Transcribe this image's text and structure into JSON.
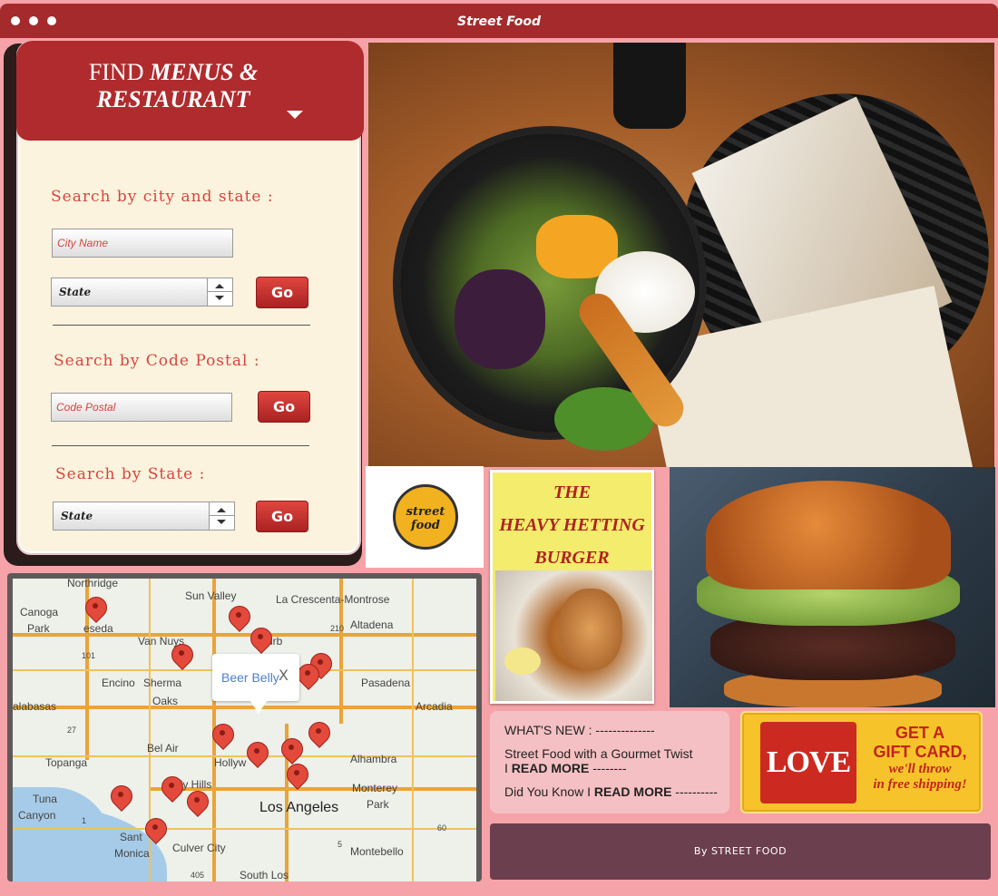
{
  "window": {
    "title": "Street Food"
  },
  "search": {
    "heading_prefix": "FIND ",
    "heading_emphasis_1": "MENUS &",
    "heading_emphasis_2": "RESTAURANT",
    "city_section_label": "Search by city and state :",
    "city_placeholder": "City Name",
    "state_select_value": "State",
    "postal_section_label": "Search by Code Postal :",
    "postal_placeholder": "Code Postal",
    "state_section_label": "Search by State :",
    "state_select_value_2": "State",
    "go_label": "Go"
  },
  "logo": {
    "text_1": "street",
    "text_2": "food"
  },
  "promo": {
    "line_1": "THE",
    "line_2": "HEAVY HETTING",
    "line_3": "BURGER"
  },
  "map": {
    "popup_label": "Beer Belly",
    "popup_close": "X",
    "labels": {
      "northridge": "Northridge",
      "sun_valley": "Sun Valley",
      "la_crescenta": "La Crescenta-Montrose",
      "canoga_park_1": "Canoga",
      "canoga_park_2": "Park",
      "reseda": "eseda",
      "van_nuys": "Van Nuys",
      "burbank": "Burb",
      "altadena": "Altadena",
      "encino": "Encino",
      "sherman_oaks_1": "Sherma",
      "sherman_oaks_2": "Oaks",
      "pasadena": "Pasadena",
      "calabasas": "alabasas",
      "arcadia": "Arcadia",
      "bel_air": "Bel Air",
      "alhambra": "Alhambra",
      "topanga": "Topanga",
      "hollywood": "Hollyw",
      "beverly_hills": "verly Hills",
      "monterey_park_1": "Monterey",
      "monterey_park_2": "Park",
      "los_angeles": "Los Angeles",
      "tuna": "Tuna",
      "canyon": "Canyon",
      "santa_monica_1": "Sant",
      "santa_monica_2": "Monica",
      "culver_city": "Culver City",
      "montebello": "Montebello",
      "south_los": "South Los",
      "route_101": "101",
      "route_210": "210",
      "route_27": "27",
      "route_1": "1",
      "route_5": "5",
      "route_60": "60",
      "route_405": "405"
    }
  },
  "news": {
    "heading": "WHAT'S NEW : --------------",
    "item_1_text": "Street Food with a Gourmet Twist",
    "item_1_prefix": "I ",
    "item_1_link": "READ MORE",
    "item_1_suffix": " --------",
    "item_2_text": "Did You Know I ",
    "item_2_link": "READ MORE",
    "item_2_suffix": " ----------"
  },
  "gift": {
    "card_text": "LOVE",
    "line_1": "GET A",
    "line_2": "GIFT CARD,",
    "line_3": "we'll throw",
    "line_4": "in free shipping!"
  },
  "footer": {
    "text": "By STREET FOOD"
  },
  "colors": {
    "accent": "#b02b2d",
    "background": "#f5a3a8",
    "footer": "#6c3f4e",
    "link": "#4a7ed9"
  }
}
